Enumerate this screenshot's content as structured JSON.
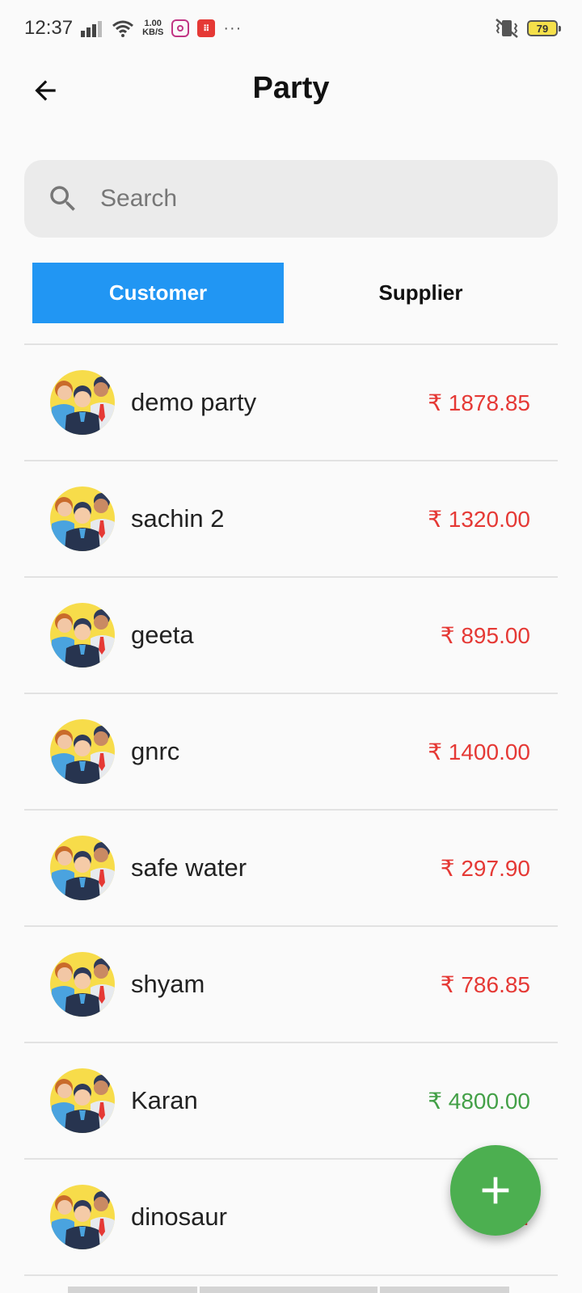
{
  "status_bar": {
    "time": "12:37",
    "net_speed_value": "1.00",
    "net_speed_unit": "KB/S",
    "red_app_icon_text": "⠿",
    "more": "···",
    "battery": "79"
  },
  "header": {
    "title": "Party"
  },
  "search": {
    "placeholder": "Search",
    "value": ""
  },
  "tabs": [
    {
      "label": "Customer",
      "active": true
    },
    {
      "label": "Supplier",
      "active": false
    }
  ],
  "parties": [
    {
      "name": "demo party",
      "amount": "₹ 1878.85",
      "status": "due"
    },
    {
      "name": "sachin 2",
      "amount": "₹ 1320.00",
      "status": "due"
    },
    {
      "name": "geeta",
      "amount": "₹ 895.00",
      "status": "due"
    },
    {
      "name": "gnrc",
      "amount": "₹ 1400.00",
      "status": "due"
    },
    {
      "name": "safe water",
      "amount": "₹ 297.90",
      "status": "due"
    },
    {
      "name": "shyam",
      "amount": "₹ 786.85",
      "status": "due"
    },
    {
      "name": "Karan",
      "amount": "₹ 4800.00",
      "status": "paid"
    },
    {
      "name": "dinosaur",
      "amount": "₹ …",
      "status": "due"
    }
  ],
  "colors": {
    "accent": "#2196f3",
    "due": "#e53935",
    "paid": "#43a047",
    "fab": "#4caf50"
  },
  "icons": {
    "back": "arrow-left-icon",
    "search": "search-icon",
    "fab": "plus-icon",
    "avatar": "people-group-icon"
  }
}
